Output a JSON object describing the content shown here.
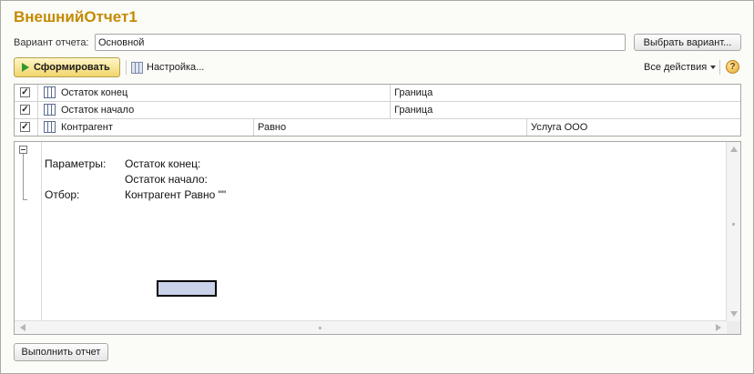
{
  "window": {
    "title": "ВнешнийОтчет1"
  },
  "variant": {
    "label": "Вариант отчета:",
    "value": "Основной",
    "choose_label": "Выбрать вариант..."
  },
  "toolbar": {
    "generate_label": "Сформировать",
    "settings_label": "Настройка...",
    "all_actions_label": "Все действия",
    "help_symbol": "?"
  },
  "params": {
    "rows": [
      {
        "checked": true,
        "field": "Остаток конец",
        "condition": "Граница",
        "value": ""
      },
      {
        "checked": true,
        "field": "Остаток начало",
        "condition": "Граница",
        "value": ""
      },
      {
        "checked": true,
        "field": "Контрагент",
        "condition": "Равно",
        "value": "Услуга ООО"
      }
    ]
  },
  "report": {
    "params_label": "Параметры:",
    "param_line1": "Остаток конец:",
    "param_line2": "Остаток начало:",
    "filter_label": "Отбор:",
    "filter_value": "Контрагент Равно \"\""
  },
  "footer": {
    "run_label": "Выполнить отчет"
  },
  "colors": {
    "title": "#c48a00",
    "generate_bg": "#f1d56b",
    "selection": "#cbd3ea"
  },
  "icons": [
    "play-icon",
    "settings-icon",
    "chevron-down-icon",
    "help-icon",
    "checkbox-icon",
    "field-icon",
    "group-collapse-icon",
    "scroll-up-icon",
    "scroll-down-icon",
    "scroll-left-icon",
    "scroll-right-icon"
  ]
}
